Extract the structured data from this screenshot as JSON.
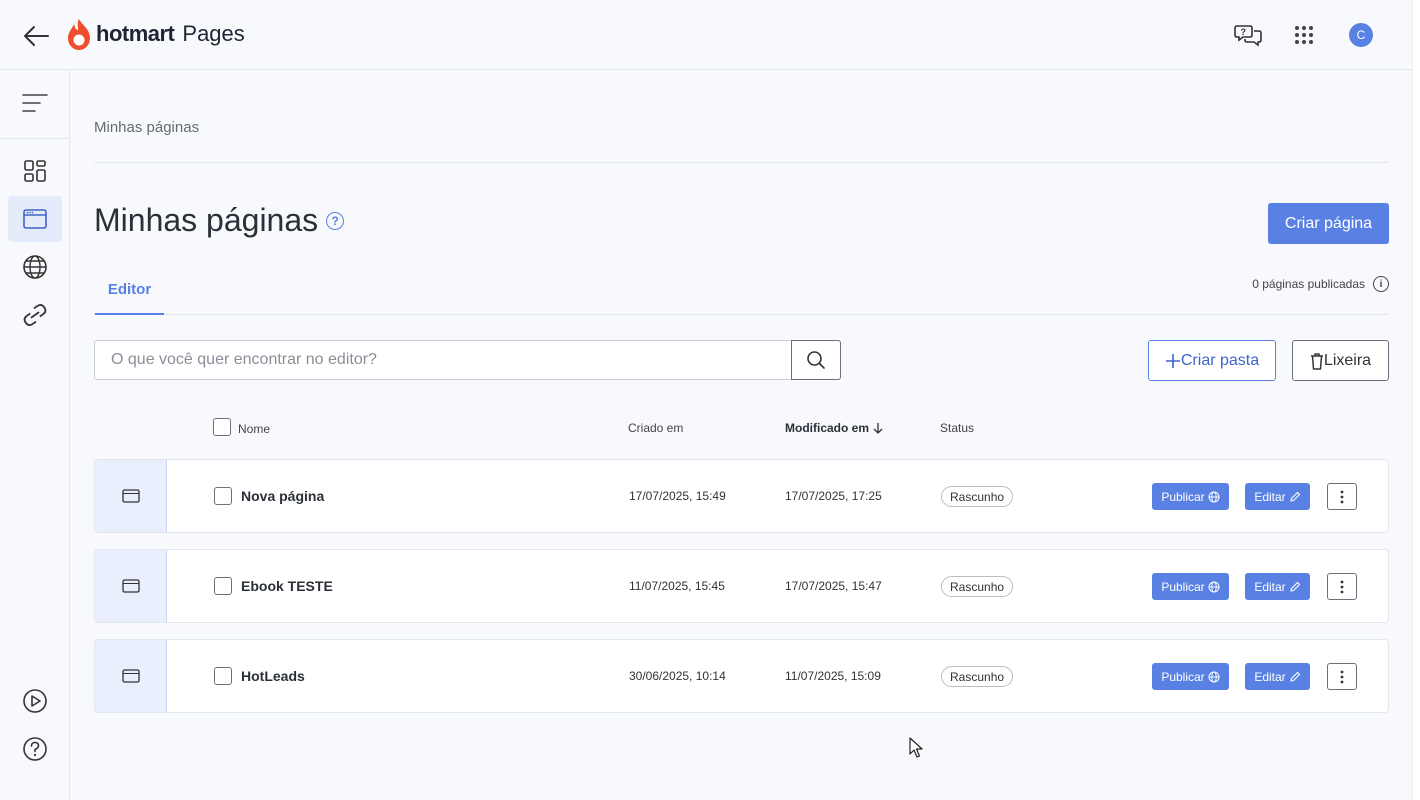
{
  "header": {
    "logo_text": "hotmart",
    "logo_sub": "Pages",
    "avatar_initial": "C"
  },
  "breadcrumb": "Minhas páginas",
  "page": {
    "title": "Minhas páginas",
    "create_button": "Criar página"
  },
  "tabs": [
    {
      "label": "Editor",
      "active": true
    }
  ],
  "published_count": "0 páginas publicadas",
  "search": {
    "placeholder": "O que você quer encontrar no editor?",
    "value": ""
  },
  "actions": {
    "create_folder": "Criar pasta",
    "trash": "Lixeira"
  },
  "table": {
    "headers": {
      "name": "Nome",
      "created": "Criado em",
      "modified": "Modificado em",
      "status": "Status"
    },
    "rows": [
      {
        "name": "Nova página",
        "created": "17/07/2025, 15:49",
        "modified": "17/07/2025, 17:25",
        "status": "Rascunho",
        "publish": "Publicar",
        "edit": "Editar"
      },
      {
        "name": "Ebook TESTE",
        "created": "11/07/2025, 15:45",
        "modified": "17/07/2025, 15:47",
        "status": "Rascunho",
        "publish": "Publicar",
        "edit": "Editar"
      },
      {
        "name": "HotLeads",
        "created": "30/06/2025, 10:14",
        "modified": "11/07/2025, 15:09",
        "status": "Rascunho",
        "publish": "Publicar",
        "edit": "Editar"
      }
    ]
  },
  "colors": {
    "accent": "#5981e3",
    "brand_flame": "#ef4f2f"
  }
}
